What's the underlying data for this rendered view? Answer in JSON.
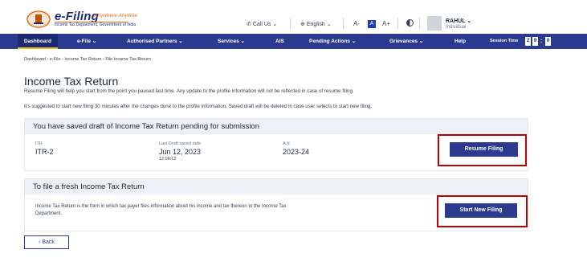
{
  "header": {
    "logo_title": "e-Filing",
    "logo_tagline": "Anywhere Anytime",
    "logo_subtitle": "Income Tax Department, Government of India",
    "call_us": "Call Us",
    "language": "English",
    "font_decrease": "A-",
    "font_normal": "A",
    "font_increase": "A+",
    "user_name": "RAHUL",
    "user_role": "Individual"
  },
  "nav": {
    "items": [
      {
        "label": "Dashboard"
      },
      {
        "label": "e-File ⌄"
      },
      {
        "label": "Authorised Partners ⌄"
      },
      {
        "label": "Services ⌄"
      },
      {
        "label": "AIS"
      },
      {
        "label": "Pending Actions ⌄"
      },
      {
        "label": "Grievances ⌄"
      },
      {
        "label": "Help"
      }
    ],
    "session_label": "Session Time",
    "session_digits": [
      "2",
      "9",
      ":",
      "0"
    ]
  },
  "breadcrumb": "Dashboard  ›  e-File  ›  Income Tax Return  ›  File Income Tax Return",
  "page": {
    "title": "Income Tax Return",
    "note1": "Resume Filing will help you start from the point you paused last time. Any update to the profile information will not be reflected in case of resume filing.",
    "note2": "It's suggested to start new filing 30 minutes after the changes done to the profile information. Saved draft will be deleted in case user selects to start new filing."
  },
  "draft_card": {
    "heading": "You have saved draft of Income Tax Return pending for submission",
    "itr_label": "ITR",
    "itr_value": "ITR-2",
    "saved_label": "Last Draft saved date",
    "saved_date": "Jun 12, 2023",
    "saved_time": "12:06:12",
    "ay_label": "A.Y.",
    "ay_value": "2023-24",
    "resume_button": "Resume Filing"
  },
  "fresh_card": {
    "heading": "To file a fresh Income Tax Return",
    "description": "Income Tax Return is the form in which tax payer files information about his income and tax thereon to the Income Tax Department.",
    "start_button": "Start New Filing"
  },
  "back_button": "‹  Back",
  "colors": {
    "brand_navy": "#2b3a8f",
    "accent_orange": "#e36b1a",
    "highlight_red": "#c00000"
  }
}
